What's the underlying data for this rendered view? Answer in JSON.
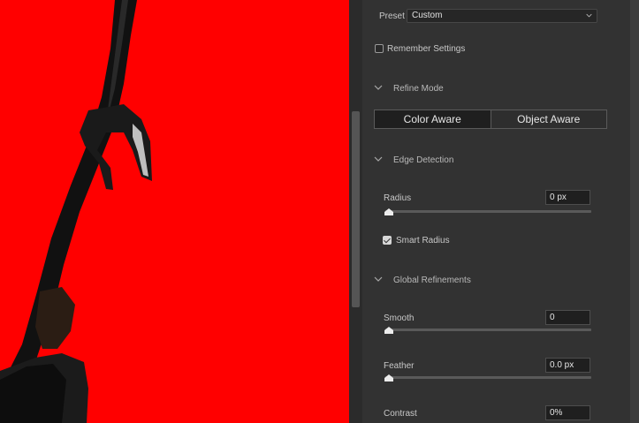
{
  "preset": {
    "label": "Preset",
    "value": "Custom"
  },
  "remember_settings": {
    "label": "Remember Settings",
    "checked": false
  },
  "refine_mode": {
    "title": "Refine Mode",
    "options": [
      "Color Aware",
      "Object Aware"
    ],
    "selected": "Color Aware"
  },
  "edge_detection": {
    "title": "Edge Detection",
    "radius": {
      "label": "Radius",
      "value": "0 px",
      "level": 0
    },
    "smart_radius": {
      "label": "Smart Radius",
      "checked": true
    }
  },
  "global_refinements": {
    "title": "Global Refinements",
    "smooth": {
      "label": "Smooth",
      "value": "0",
      "level": 0
    },
    "feather": {
      "label": "Feather",
      "value": "0.0 px",
      "level": 0
    },
    "contrast": {
      "label": "Contrast",
      "value": "0%"
    }
  },
  "colors": {
    "overlay": "#ff0000",
    "panel": "#323232"
  },
  "icons": [
    "chevron-down-icon",
    "section-collapse-icon",
    "slider-thumb-icon",
    "checkbox-icon"
  ]
}
